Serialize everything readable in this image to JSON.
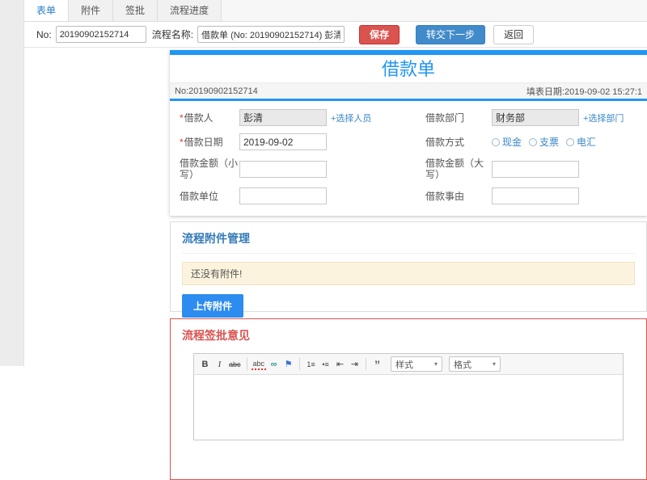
{
  "tabs": [
    {
      "label": "表单",
      "active": true
    },
    {
      "label": "附件",
      "active": false
    },
    {
      "label": "签批",
      "active": false
    },
    {
      "label": "流程进度",
      "active": false
    }
  ],
  "toolbar": {
    "no_label": "No:",
    "no_value": "20190902152714",
    "process_name_label": "流程名称:",
    "process_name_value": "借款单 (No: 20190902152714) 彭清",
    "save_label": "保存",
    "next_label": "转交下一步",
    "back_label": "返回"
  },
  "form": {
    "title": "借款单",
    "no_text": "No:20190902152714",
    "date_text": "填表日期:2019-09-02 15:27:1",
    "required_mark": "*",
    "borrower_label": "借款人",
    "borrower_value": "彭清",
    "borrower_link": "+选择人员",
    "dept_label": "借款部门",
    "dept_value": "财务部",
    "dept_link": "+选择部门",
    "date_label": "借款日期",
    "date_value": "2019-09-02",
    "method_label": "借款方式",
    "method_options": [
      "现金",
      "支票",
      "电汇"
    ],
    "amount_lower_label": "借款金额（小写）",
    "amount_upper_label": "借款金额（大写）",
    "unit_label": "借款单位",
    "reason_label": "借款事由"
  },
  "attachments": {
    "title": "流程附件管理",
    "empty_text": "还没有附件!",
    "upload_label": "上传附件"
  },
  "approval": {
    "title": "流程签批意见",
    "editor": {
      "bold": "B",
      "italic": "I",
      "strike": "abc",
      "spellcheck": "abc",
      "link": "∞",
      "flag": "⚑",
      "ol": "1≡",
      "ul": "•≡",
      "outdent": "⇤",
      "indent": "⇥",
      "quote": "”",
      "style_label": "样式",
      "format_label": "格式",
      "caret": "▾"
    }
  }
}
